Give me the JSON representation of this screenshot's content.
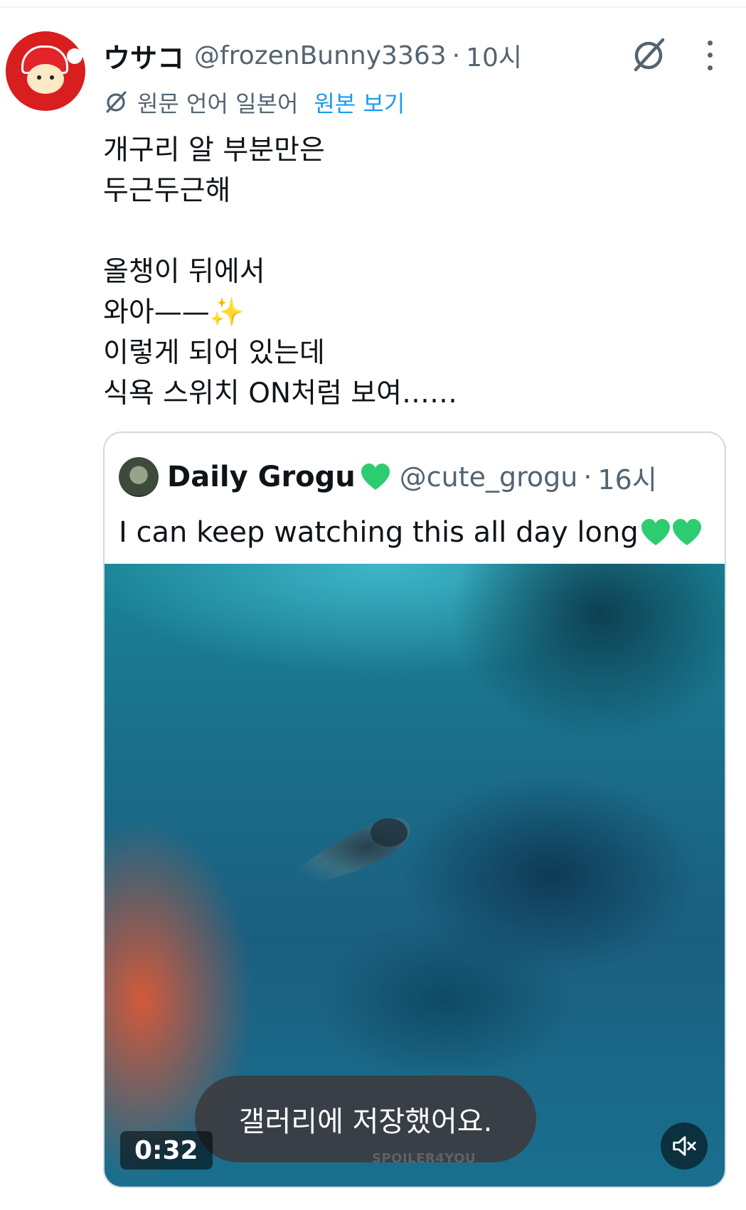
{
  "tweet": {
    "author_name": "ウサコ",
    "handle": "@frozenBunny3363",
    "separator": "·",
    "time": "10시",
    "translation": {
      "label": "원문 언어 일본어",
      "link": "원본 보기"
    },
    "lines": [
      "개구리 알 부분만은",
      "두근두근해",
      "",
      "올챙이 뒤에서",
      "와아——✨",
      "이렇게 되어 있는데",
      "식욕 스위치 ON처럼 보여……"
    ]
  },
  "quoted": {
    "author_name": "Daily Grogu",
    "handle": "@cute_grogu",
    "separator": "·",
    "time": "16시",
    "text": "I can keep watching this all day long",
    "heart_color": "#2ecc71"
  },
  "video": {
    "duration": "0:32",
    "toast": "갤러리에 저장했어요.",
    "watermark": "SPOILER4YOU",
    "mute_icon": "mute-speaker-icon"
  },
  "icons": {
    "grok": "grok-icon",
    "more": "more-dots-icon",
    "translate": "grok-translate-icon"
  },
  "colors": {
    "link": "#1d9bf0",
    "secondary_text": "#536471",
    "border": "#cfd9de"
  }
}
